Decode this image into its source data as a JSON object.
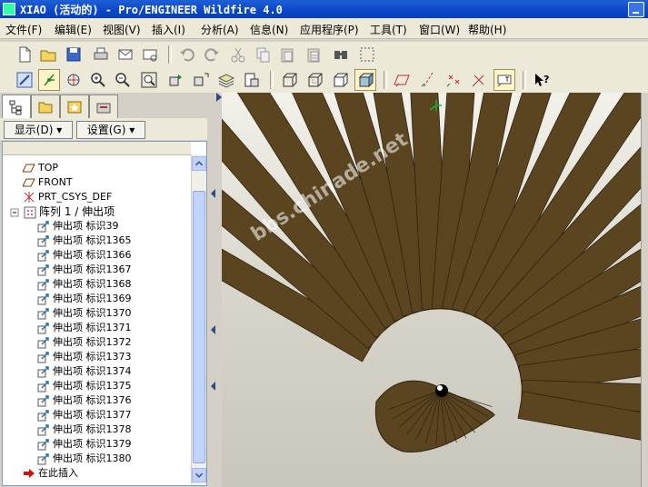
{
  "window": {
    "title": "XIAO (活动的) - Pro/ENGINEER Wildfire 4.0"
  },
  "menu": [
    "文件(F)",
    "编辑(E)",
    "视图(V)",
    "插入(I)",
    "分析(A)",
    "信息(N)",
    "应用程序(P)",
    "工具(T)",
    "窗口(W)",
    "帮助(H)"
  ],
  "panel": {
    "show_button": "显示(D)",
    "settings_button": "设置(G)"
  },
  "tree": {
    "datums": [
      "TOP",
      "FRONT",
      "PRT_CSYS_DEF"
    ],
    "pattern_label": "阵列 1 / 伸出项",
    "features": [
      "伸出项 标识39",
      "伸出项 标识1365",
      "伸出项 标识1366",
      "伸出项 标识1367",
      "伸出项 标识1368",
      "伸出项 标识1369",
      "伸出项 标识1370",
      "伸出项 标识1371",
      "伸出项 标识1372",
      "伸出项 标识1373",
      "伸出项 标识1374",
      "伸出项 标识1375",
      "伸出项 标识1376",
      "伸出项 标识1377",
      "伸出项 标识1378",
      "伸出项 标识1379",
      "伸出项 标识1380"
    ],
    "insert_here": "在此插入"
  },
  "viewport": {
    "watermark": "bbs.chinade.net",
    "model_color": "#5b4520",
    "edge_color": "#2e2210"
  },
  "icons": {
    "toolbar1": [
      "new-file-icon",
      "open-folder-icon",
      "save-icon",
      "print-icon",
      "email-icon",
      "email-attach-icon",
      "undo-icon",
      "redo-icon",
      "cut-icon",
      "copy-icon",
      "paste-icon",
      "paste-special-icon",
      "find-icon",
      "select-box-icon"
    ],
    "toolbar2": [
      "repaint-icon",
      "spin-center-icon",
      "orient-icon",
      "zoom-in-icon",
      "zoom-out-icon",
      "refit-icon",
      "reorient-icon",
      "saved-views-icon",
      "layers-icon",
      "view-manager-icon",
      "wireframe-icon",
      "hidden-line-icon",
      "no-hidden-icon",
      "shading-icon",
      "datum-plane-icon",
      "datum-axis-icon",
      "datum-point-icon",
      "datum-csys-icon",
      "annotation-icon",
      "context-help-icon"
    ]
  }
}
